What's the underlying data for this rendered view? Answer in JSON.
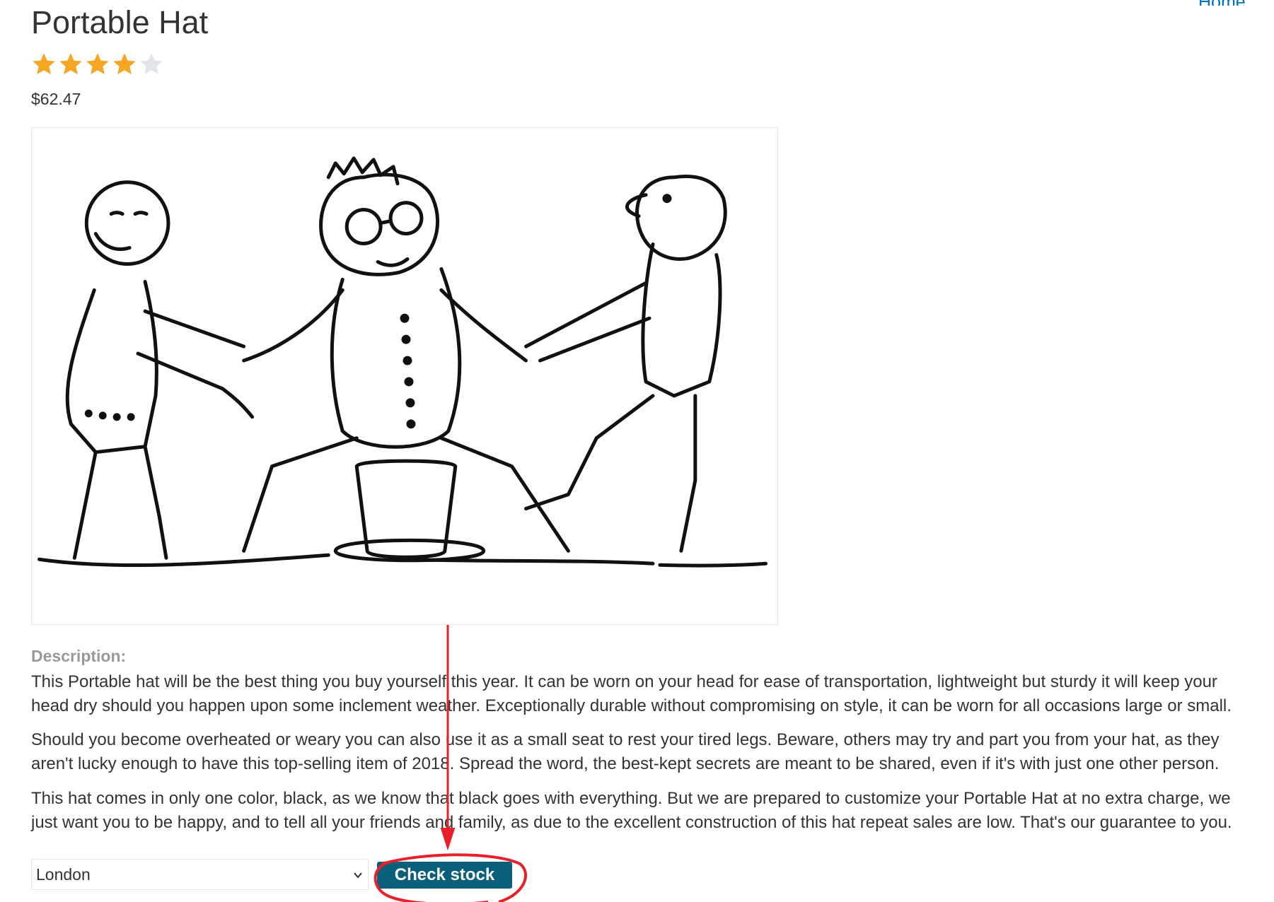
{
  "header": {
    "home_link": "Home"
  },
  "product": {
    "title": "Portable Hat",
    "rating": {
      "value": 4,
      "max": 5
    },
    "price": "$62.47",
    "image": {
      "description": "illustration"
    },
    "description_heading": "Description:",
    "description_paragraphs": [
      "This Portable hat will be the best thing you buy yourself this year. It can be worn on your head for ease of transportation, lightweight but sturdy it will keep your head dry should you happen upon some inclement weather. Exceptionally durable without compromising on style, it can be worn for all occasions large or small.",
      "Should you become overheated or weary you can also use it as a small seat to rest your tired legs. Beware, others may try and part you from your hat, as they aren't lucky enough to have this top-selling item of 2018. Spread the word, the best-kept secrets are meant to be shared, even if it's with just one other person.",
      "This hat comes in only one color, black, as we know that black goes with everything. But we are prepared to customize your Portable Hat at no extra charge, we just want you to be happy, and to tell all your friends and family, as due to the excellent construction of this hat repeat sales are low. That's our guarantee to you."
    ]
  },
  "stock_check": {
    "selected_store": "London",
    "button_label": "Check stock"
  },
  "colors": {
    "star_filled": "#f5a623",
    "star_empty": "#e1e5ea",
    "button": "#0a5f7a",
    "link": "#0071bc",
    "annotation": "#e8202a"
  },
  "icons": {
    "star": "star-icon",
    "dropdown": "chevron-down-icon"
  }
}
